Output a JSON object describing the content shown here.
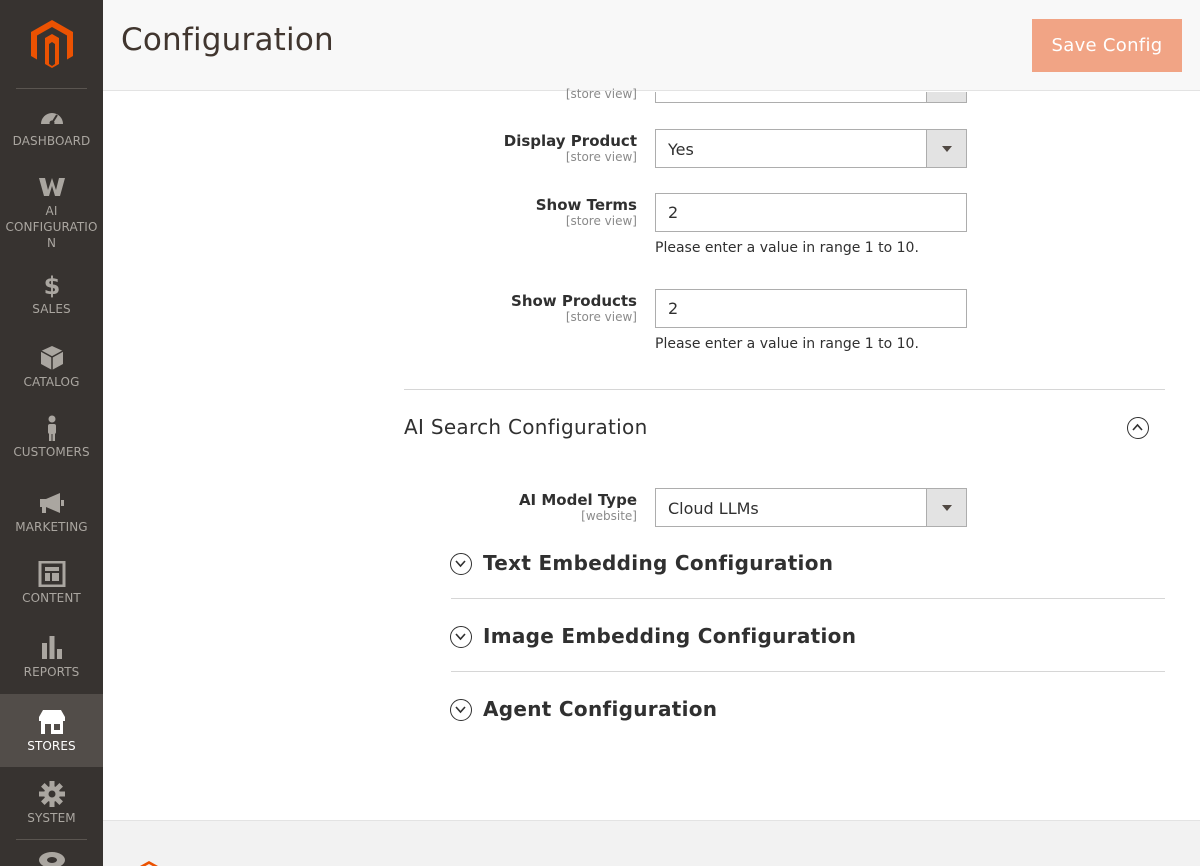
{
  "header": {
    "title": "Configuration",
    "save_label": "Save Config"
  },
  "sidebar": {
    "items": [
      {
        "label": "Dashboard",
        "icon": "dashboard-icon"
      },
      {
        "label": "AI Configuratio n",
        "icon": "ai-configuration-icon"
      },
      {
        "label": "Sales",
        "icon": "dollar-icon"
      },
      {
        "label": "Catalog",
        "icon": "box-icon"
      },
      {
        "label": "Customers",
        "icon": "person-icon"
      },
      {
        "label": "Marketing",
        "icon": "megaphone-icon"
      },
      {
        "label": "Content",
        "icon": "layout-icon"
      },
      {
        "label": "Reports",
        "icon": "bar-chart-icon"
      },
      {
        "label": "Stores",
        "icon": "storefront-icon",
        "active": true
      },
      {
        "label": "System",
        "icon": "gear-icon"
      }
    ]
  },
  "form": {
    "top_scope": "[store view]",
    "display_product": {
      "label": "Display Product",
      "scope": "[store view]",
      "value": "Yes"
    },
    "show_terms": {
      "label": "Show Terms",
      "scope": "[store view]",
      "value": "2",
      "note": "Please enter a value in range 1 to 10."
    },
    "show_products": {
      "label": "Show Products",
      "scope": "[store view]",
      "value": "2",
      "note": "Please enter a value in range 1 to 10."
    }
  },
  "ai_search": {
    "title": "AI Search Configuration",
    "model_type": {
      "label": "AI Model Type",
      "scope": "[website]",
      "value": "Cloud LLMs"
    },
    "groups": [
      "Text Embedding Configuration",
      "Image Embedding Configuration",
      "Agent Configuration"
    ]
  },
  "colors": {
    "sidebar": "#373330",
    "active": "#524d49",
    "accent": "#eb5202",
    "save_button": "#f1a485"
  }
}
